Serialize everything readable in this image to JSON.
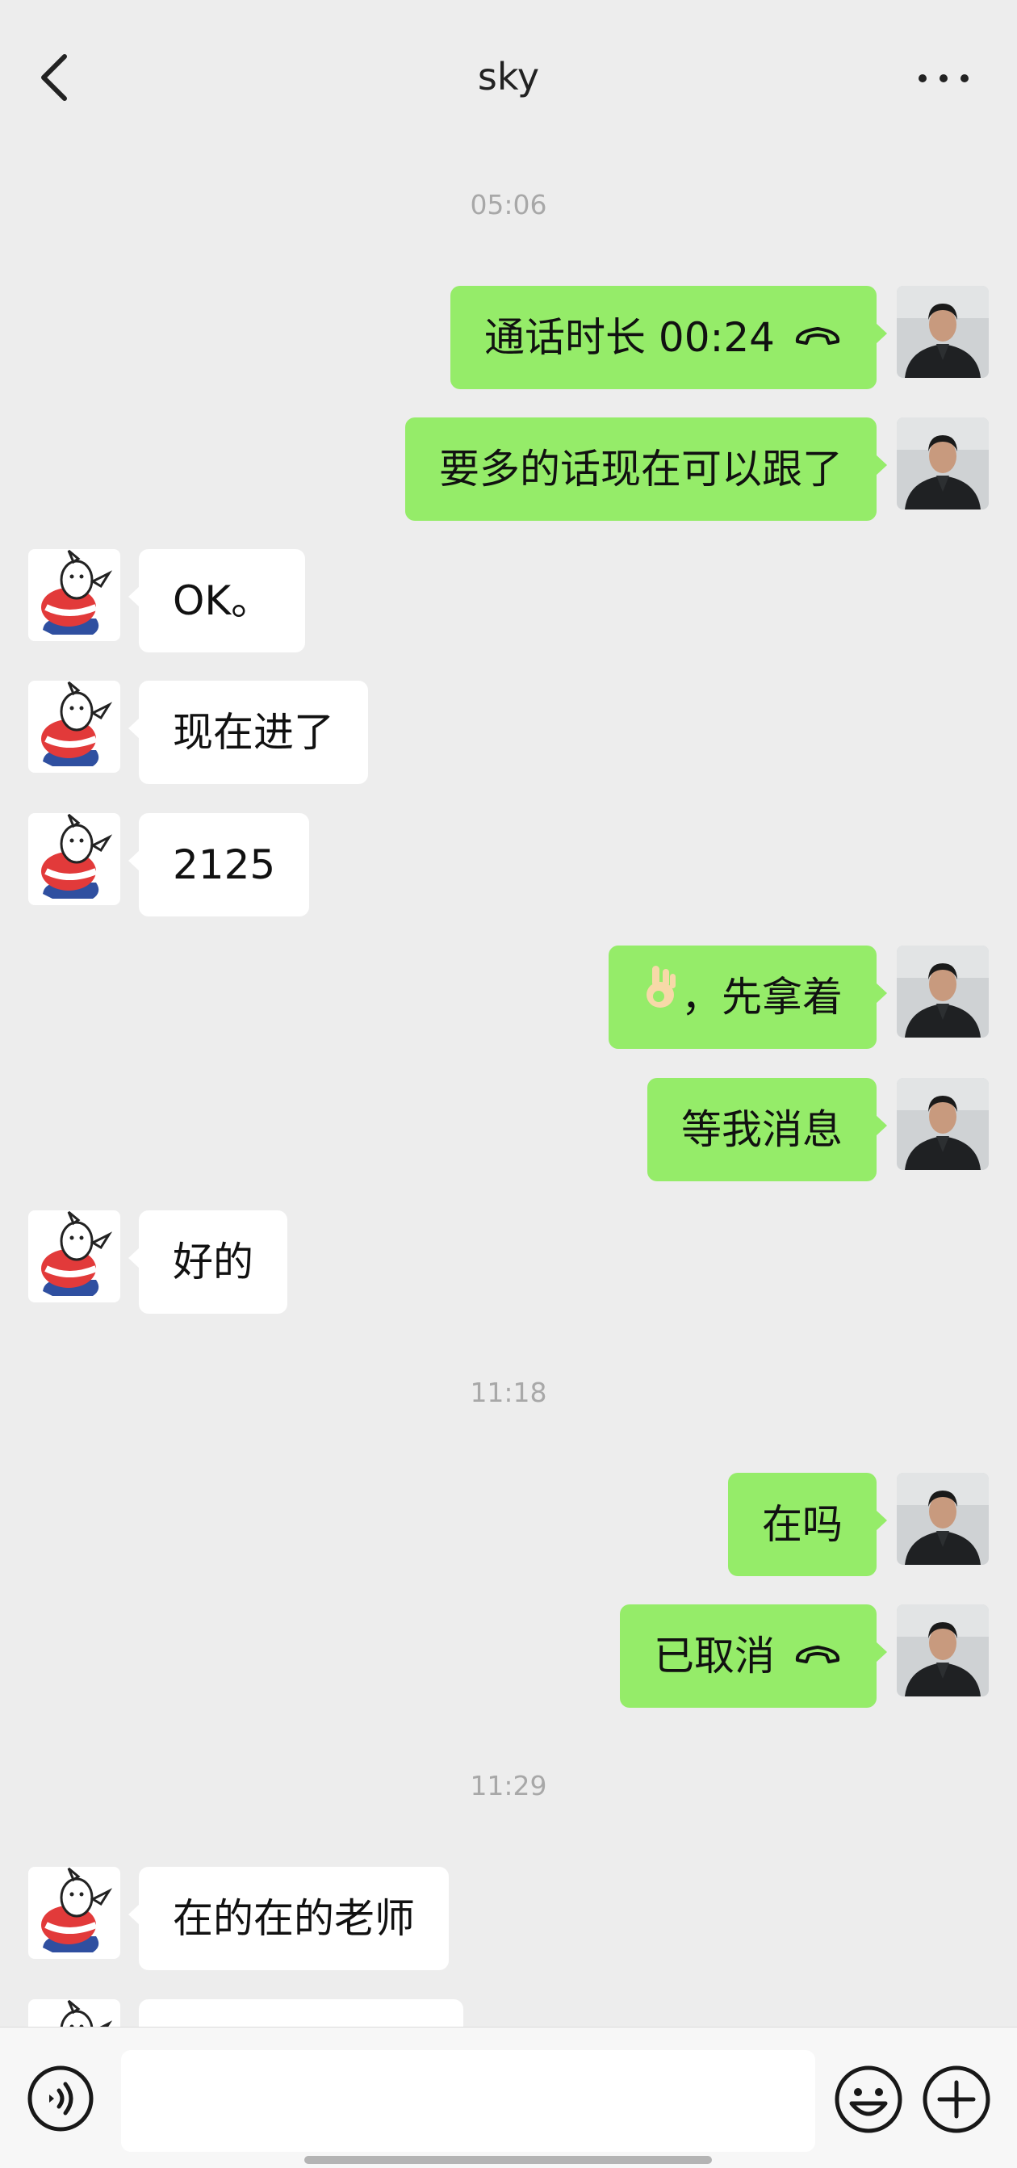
{
  "header": {
    "title": "sky",
    "back_icon": "chevron-left-icon",
    "more_icon": "more-dots-icon"
  },
  "messages": [
    {
      "type": "time",
      "text": "05:06"
    },
    {
      "type": "msg",
      "side": "right",
      "text": "通话时长 00:24",
      "icon": "phone-hangup-icon"
    },
    {
      "type": "msg",
      "side": "right",
      "text": "要多的话现在可以跟了"
    },
    {
      "type": "msg",
      "side": "left",
      "text": "OK。"
    },
    {
      "type": "msg",
      "side": "left",
      "text": "现在进了"
    },
    {
      "type": "msg",
      "side": "left",
      "text": "2125"
    },
    {
      "type": "msg",
      "side": "right",
      "text": "，先拿着",
      "emoji": "ok-hand-emoji"
    },
    {
      "type": "msg",
      "side": "right",
      "text": "等我消息"
    },
    {
      "type": "msg",
      "side": "left",
      "text": "好的"
    },
    {
      "type": "time",
      "text": "11:18"
    },
    {
      "type": "msg",
      "side": "right",
      "text": "在吗"
    },
    {
      "type": "msg",
      "side": "right",
      "text": "已取消",
      "icon": "phone-hangup-icon"
    },
    {
      "type": "time",
      "text": "11:29"
    },
    {
      "type": "msg",
      "side": "left",
      "text": "在的在的老师"
    }
  ],
  "input_bar": {
    "input_value": "",
    "voice_icon": "voice-icon",
    "emoji_icon": "emoji-icon",
    "plus_icon": "plus-icon"
  },
  "colors": {
    "background": "#ededed",
    "self_bubble": "#95ec69",
    "other_bubble": "#ffffff",
    "timestamp": "#a8a8a8"
  }
}
